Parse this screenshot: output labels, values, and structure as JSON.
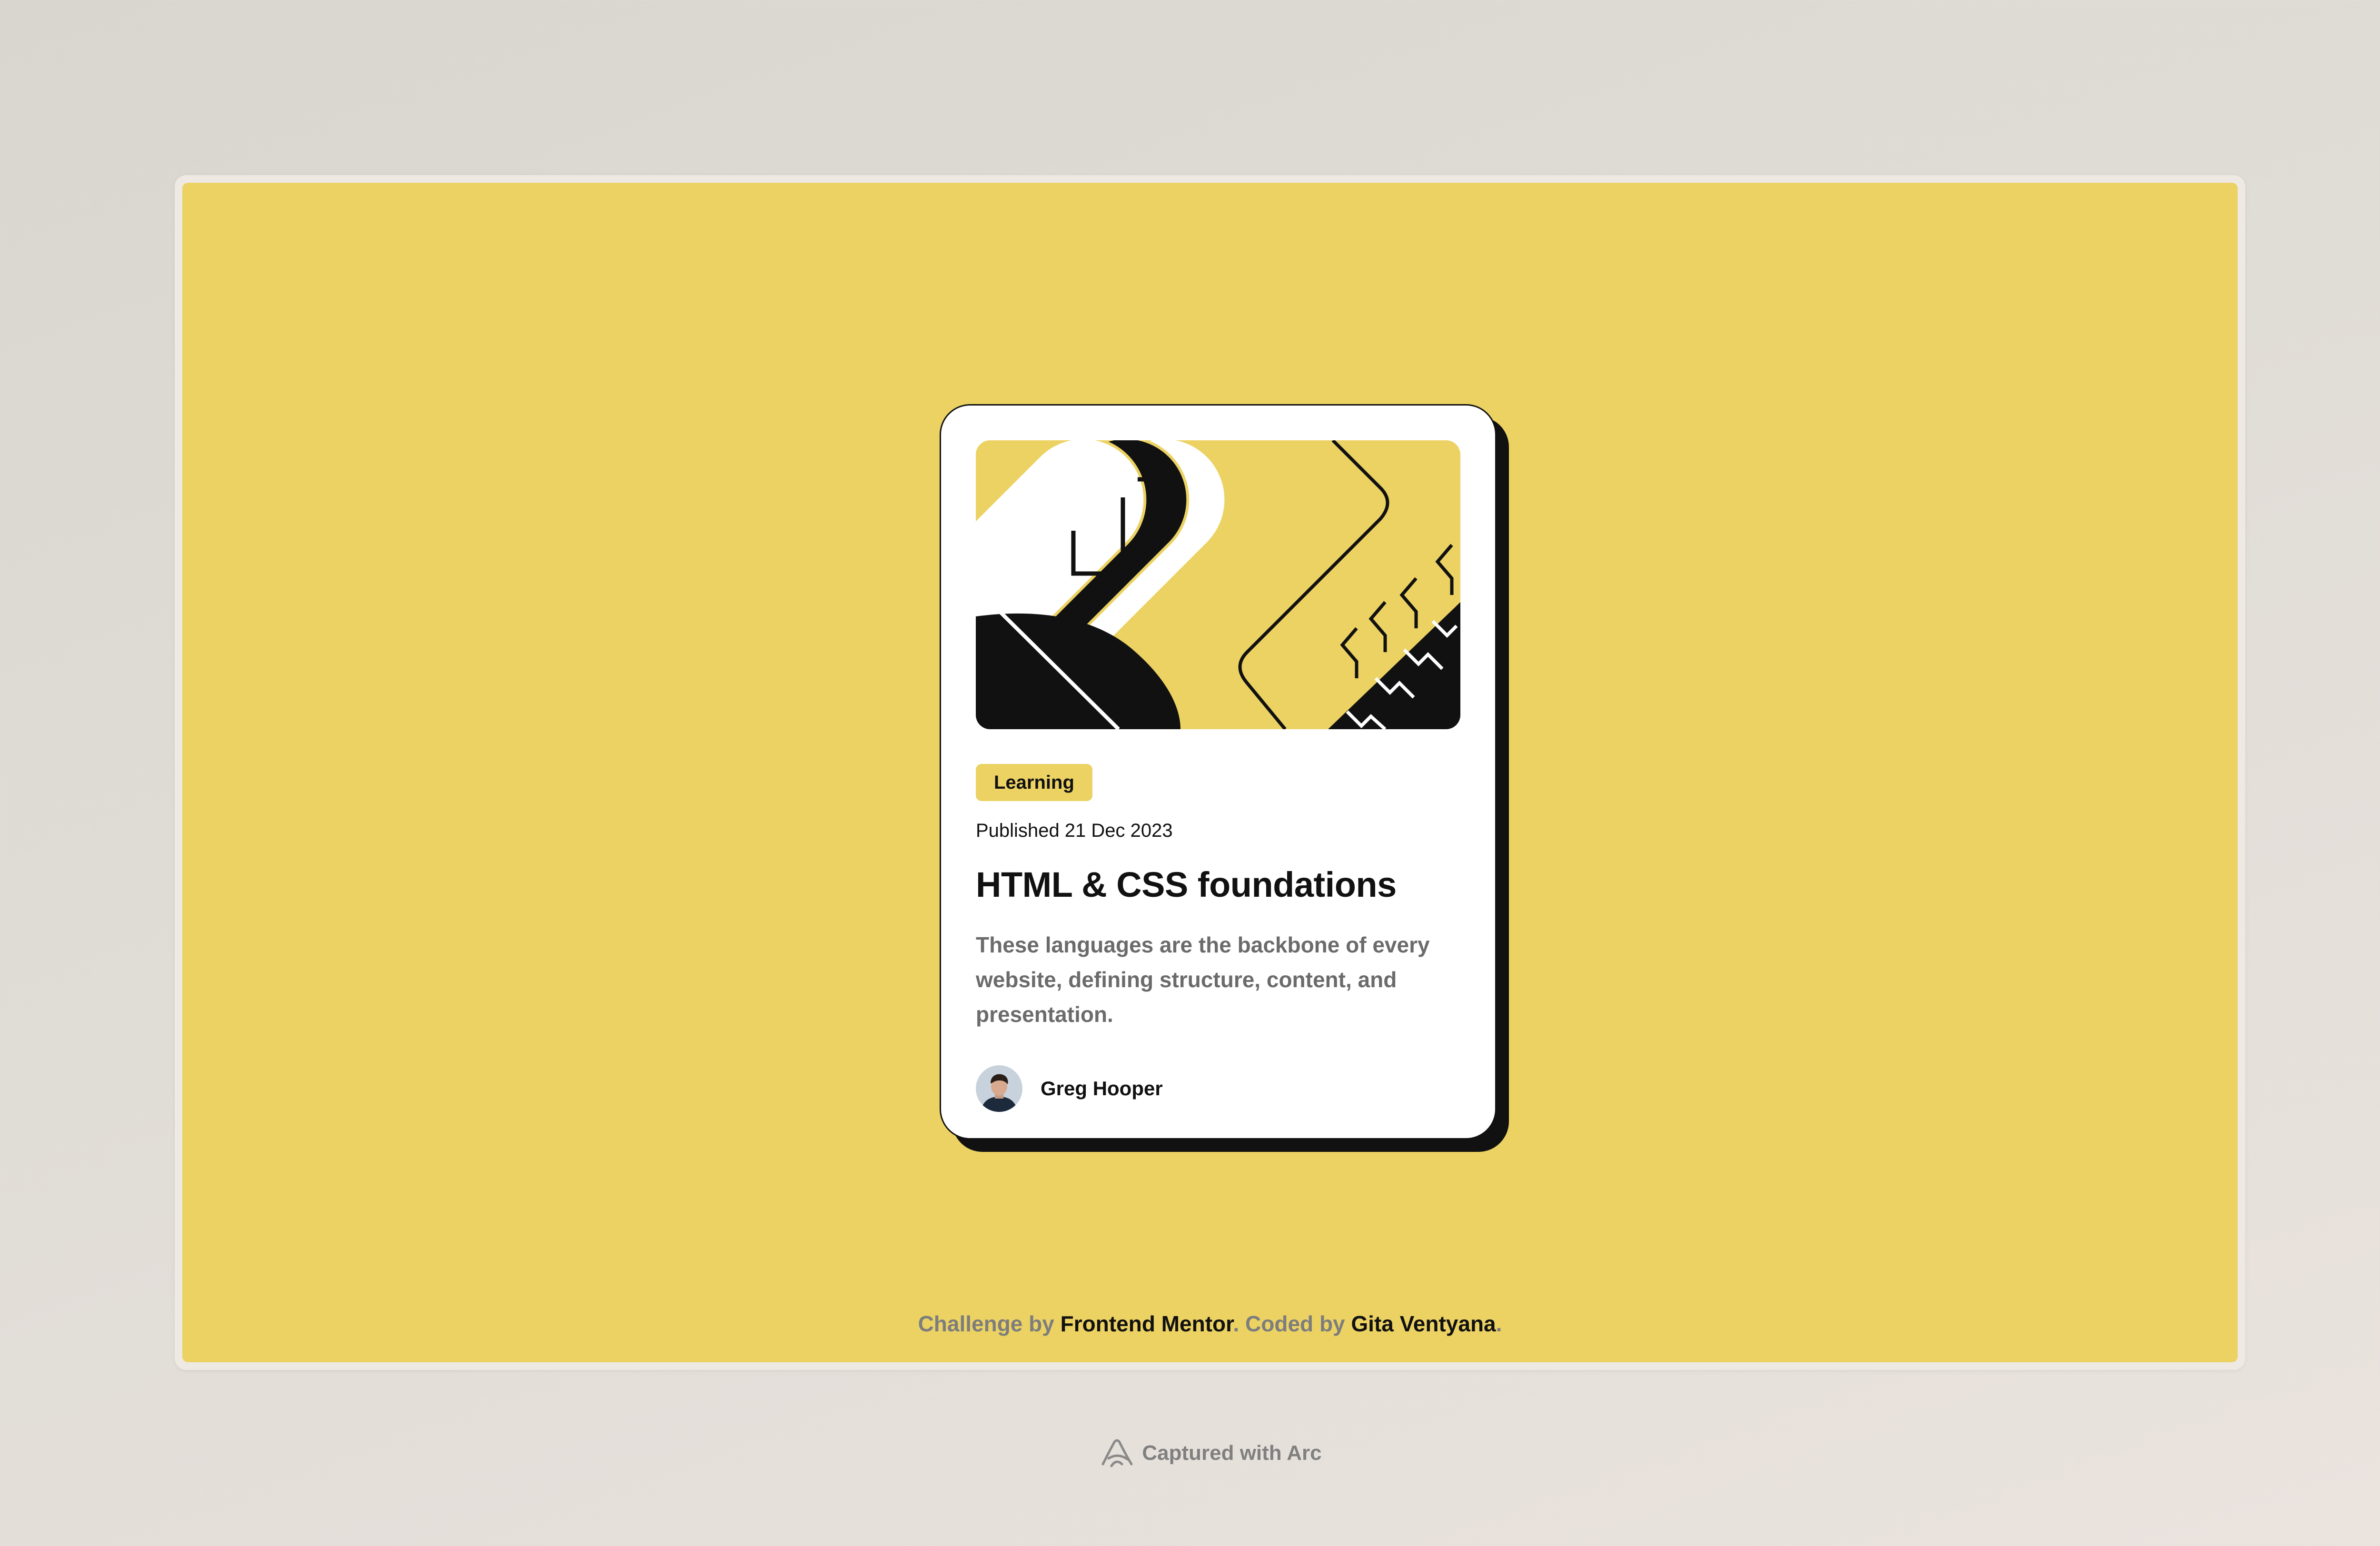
{
  "card": {
    "tag": "Learning",
    "published": "Published 21 Dec 2023",
    "title": "HTML & CSS foundations",
    "description": "These languages are the backbone of every website, defining structure, content, and presentation.",
    "author": "Greg Hooper"
  },
  "attribution": {
    "prefix": "Challenge by ",
    "link1": "Frontend Mentor",
    "middle": ". Coded by ",
    "link2": "Gita Ventyana",
    "suffix": "."
  },
  "capture": {
    "text": "Captured with Arc",
    "icon": "arc-logo-icon"
  },
  "colors": {
    "accent_yellow": "#ecd263",
    "ink": "#111111",
    "muted": "#6b6b6b",
    "card": "#ffffff",
    "page_bg": "#e0dcd6"
  }
}
